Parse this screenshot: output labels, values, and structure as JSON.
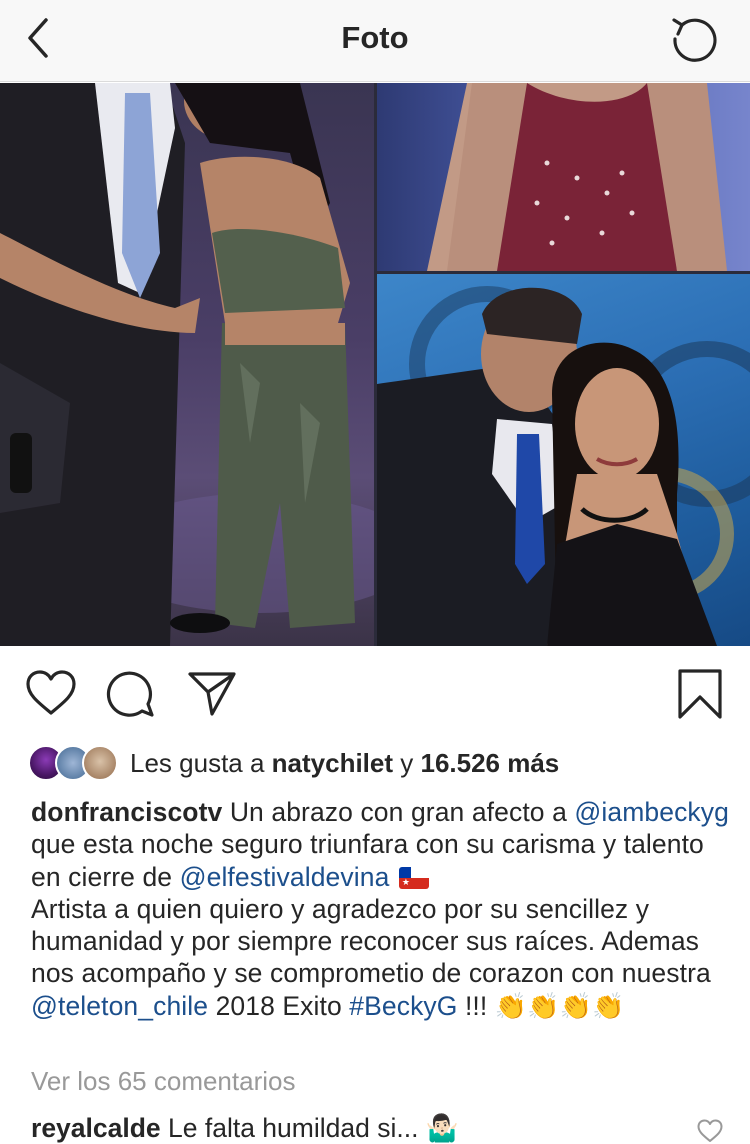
{
  "header": {
    "title": "Foto",
    "back_icon": "chevron-left-icon",
    "refresh_icon": "refresh-icon"
  },
  "post": {
    "image_alt": "Collage de fotos",
    "carousel": {
      "count": 3,
      "active_index": 2
    }
  },
  "actions": {
    "like_icon": "heart-icon",
    "comment_icon": "comment-icon",
    "share_icon": "send-icon",
    "save_icon": "bookmark-icon"
  },
  "likes": {
    "prefix": "Les gusta a ",
    "user": "natychilet",
    "middle": " y ",
    "count": "16.526 más"
  },
  "caption": {
    "username": "donfranciscotv",
    "parts": [
      " Un abrazo con gran afecto a ",
      "@iambeckyg",
      " que esta noche seguro triunfara con su carisma y talento en cierre de ",
      "@elfestivaldevina",
      " ",
      "Artista a quien quiero y agradezco por su sencillez y humanidad y por siempre reconocer sus raíces. Ademas nos acompaño y se comprometio de corazon con nuestra ",
      "@teleton_chile",
      " 2018 Exito ",
      "#BeckyG",
      " !!! ",
      "👏👏👏👏"
    ]
  },
  "comments": {
    "view_all": "Ver los 65 comentarios",
    "items": [
      {
        "user": "reyalcalde",
        "text": " Le falta humildad si... 🤷🏻‍♂️"
      }
    ]
  },
  "colors": {
    "text": "#262626",
    "mention": "#1c4f8c",
    "muted": "#999999",
    "header_bg": "#f8f8f8"
  }
}
